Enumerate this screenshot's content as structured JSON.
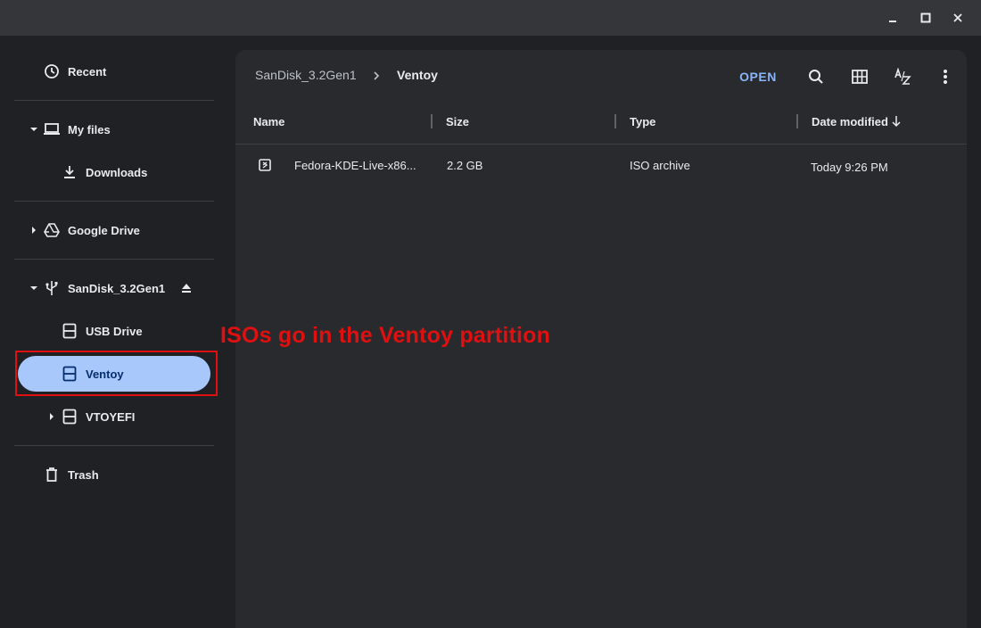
{
  "window": {
    "controls": [
      {
        "name": "minimize-button",
        "icon": "minimize-icon"
      },
      {
        "name": "maximize-button",
        "icon": "maximize-icon"
      },
      {
        "name": "close-button",
        "icon": "close-icon"
      }
    ]
  },
  "sidebar": {
    "recent": {
      "label": "Recent",
      "icon": "clock-icon"
    },
    "my_files": {
      "label": "My files",
      "icon": "laptop-icon"
    },
    "downloads": {
      "label": "Downloads",
      "icon": "download-icon"
    },
    "google_drive": {
      "label": "Google Drive",
      "icon": "google-drive-icon"
    },
    "sandisk": {
      "label": "SanDisk_3.2Gen1",
      "icon": "usb-icon"
    },
    "usb_drive": {
      "label": "USB Drive",
      "icon": "drive-icon"
    },
    "ventoy": {
      "label": "Ventoy",
      "icon": "drive-icon",
      "selected": true
    },
    "vtoyefi": {
      "label": "VTOYEFI",
      "icon": "drive-icon"
    },
    "trash": {
      "label": "Trash",
      "icon": "trash-icon"
    }
  },
  "annotation": {
    "text": "ISOs go in the Ventoy partition",
    "color": "#e01010"
  },
  "breadcrumb": {
    "root": "SanDisk_3.2Gen1",
    "current": "Ventoy"
  },
  "toolbar": {
    "open_label": "OPEN",
    "tools": [
      "search-icon",
      "grid-view-icon",
      "sort-az-icon",
      "more-vert-icon"
    ]
  },
  "file_list": {
    "columns": [
      "Name",
      "Size",
      "Type",
      "Date modified"
    ],
    "sort_column": "Date modified",
    "sort_direction": "descending",
    "rows": [
      {
        "name": "Fedora-KDE-Live-x86...",
        "size": "2.2 GB",
        "type": "ISO archive",
        "date": "Today 9:26 PM",
        "icon": "archive-icon"
      }
    ]
  },
  "colors": {
    "background": "#202124",
    "panel": "#292a2d",
    "accent": "#8ab4f8",
    "selected": "#a8c7fa"
  }
}
